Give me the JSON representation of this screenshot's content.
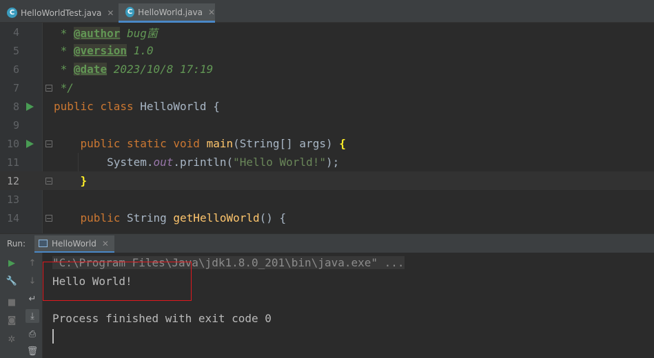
{
  "tabs": [
    {
      "label": "HelloWorldTest.java",
      "icon": "C"
    },
    {
      "label": "HelloWorld.java",
      "icon": "C",
      "active": true
    }
  ],
  "editor": {
    "lines": [
      {
        "num": "4",
        "segments": [
          {
            "t": " * ",
            "c": "cm"
          },
          {
            "t": "@author",
            "c": "tag"
          },
          {
            "t": " bug菌",
            "c": "cm"
          }
        ]
      },
      {
        "num": "5",
        "segments": [
          {
            "t": " * ",
            "c": "cm"
          },
          {
            "t": "@version",
            "c": "tag"
          },
          {
            "t": " 1.0",
            "c": "cm"
          }
        ]
      },
      {
        "num": "6",
        "segments": [
          {
            "t": " * ",
            "c": "cm"
          },
          {
            "t": "@date",
            "c": "tag"
          },
          {
            "t": " 2023/10/8 17:19",
            "c": "cm"
          }
        ]
      },
      {
        "num": "7",
        "segments": [
          {
            "t": " */",
            "c": "cm"
          }
        ]
      },
      {
        "num": "8",
        "segments": [
          {
            "t": "public class ",
            "c": "kw"
          },
          {
            "t": "HelloWorld {",
            "c": ""
          }
        ]
      },
      {
        "num": "9",
        "segments": []
      },
      {
        "num": "10",
        "segments": [
          {
            "t": "    public static void ",
            "c": "kw"
          },
          {
            "t": "main",
            "c": "fn"
          },
          {
            "t": "(String[] args) ",
            "c": ""
          },
          {
            "t": "{",
            "c": "brace"
          }
        ]
      },
      {
        "num": "11",
        "segments": [
          {
            "t": "        System.",
            "c": ""
          },
          {
            "t": "out",
            "c": "fld"
          },
          {
            "t": ".println(",
            "c": ""
          },
          {
            "t": "\"Hello World!\"",
            "c": "str"
          },
          {
            "t": ");",
            "c": ""
          }
        ]
      },
      {
        "num": "12",
        "segments": [
          {
            "t": "    ",
            "c": ""
          },
          {
            "t": "}",
            "c": "brace"
          }
        ]
      },
      {
        "num": "13",
        "segments": []
      },
      {
        "num": "14",
        "segments": [
          {
            "t": "    public ",
            "c": "kw"
          },
          {
            "t": "String ",
            "c": ""
          },
          {
            "t": "getHelloWorld",
            "c": "fn"
          },
          {
            "t": "() {",
            "c": ""
          }
        ]
      }
    ]
  },
  "run": {
    "label": "Run:",
    "tab_label": "HelloWorld",
    "console_lines": [
      "\"C:\\Program Files\\Java\\jdk1.8.0_201\\bin\\java.exe\" ...",
      "Hello World!",
      "",
      "Process finished with exit code 0"
    ]
  },
  "icons": {
    "rerun": "play-icon",
    "settings": "wrench-icon",
    "stop": "stop-icon",
    "snapshot": "camera-icon",
    "pin": "gear-icon",
    "up": "arrow-up-icon",
    "down": "arrow-down-icon",
    "wrap": "soft-wrap-icon",
    "scroll": "scroll-to-end-icon",
    "print": "print-icon",
    "clear": "trash-icon"
  },
  "colors": {
    "keyword": "#cc7832",
    "comment": "#629755",
    "string": "#6a8759",
    "function": "#ffc66d",
    "highlight": "#e0181e"
  }
}
